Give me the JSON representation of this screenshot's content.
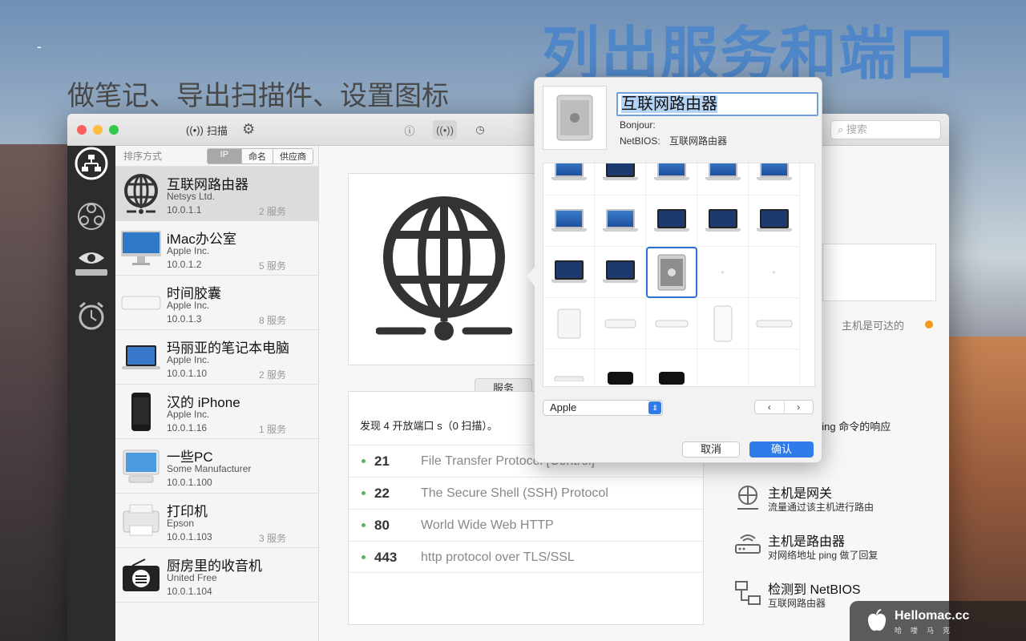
{
  "hero": {
    "title": "列出服务和端口",
    "subtitle": "做笔记、导出扫描件、设置图标",
    "dash": "-"
  },
  "toolbar": {
    "scan_label": "扫描",
    "search_placeholder": "搜索"
  },
  "sidebar": {
    "sort_label": "排序方式",
    "sort_options": [
      "IP",
      "命名",
      "供应商"
    ],
    "devices": [
      {
        "name": "互联网路由器",
        "vendor": "Netsys Ltd.",
        "ip": "10.0.1.1",
        "services": "2 服务",
        "icon": "globe-router-icon"
      },
      {
        "name": "iMac办公室",
        "vendor": "Apple Inc.",
        "ip": "10.0.1.2",
        "services": "5 服务",
        "icon": "imac-icon"
      },
      {
        "name": "时间胶囊",
        "vendor": "Apple Inc.",
        "ip": "10.0.1.3",
        "services": "8 服务",
        "icon": "time-capsule-icon"
      },
      {
        "name": "玛丽亚的笔记本电脑",
        "vendor": "Apple Inc.",
        "ip": "10.0.1.10",
        "services": "2 服务",
        "icon": "laptop-icon"
      },
      {
        "name": "汉的 iPhone",
        "vendor": "Apple Inc.",
        "ip": "10.0.1.16",
        "services": "1 服务",
        "icon": "iphone-icon"
      },
      {
        "name": "一些PC",
        "vendor": "Some Manufacturer",
        "ip": "10.0.1.100",
        "services": "",
        "icon": "pc-icon"
      },
      {
        "name": "打印机",
        "vendor": "Epson",
        "ip": "10.0.1.103",
        "services": "3 服务",
        "icon": "printer-icon"
      },
      {
        "name": "厨房里的收音机",
        "vendor": "United Free",
        "ip": "10.0.1.104",
        "services": "",
        "icon": "radio-icon"
      }
    ]
  },
  "services": {
    "tab_label": "服务",
    "summary": "发现 4 开放端口 s（0 扫描）。",
    "rows": [
      {
        "port": "21",
        "desc": "File Transfer Protocol [Control]"
      },
      {
        "port": "22",
        "desc": "The Secure Shell (SSH) Protocol"
      },
      {
        "port": "80",
        "desc": "World Wide Web HTTP"
      },
      {
        "port": "443",
        "desc": "http protocol over TLS/SSL"
      }
    ]
  },
  "right": {
    "reachable": "主机是可达的",
    "ping_text": "ping 命令的响应",
    "features": [
      {
        "title": "主机是网关",
        "desc": "流量通过该主机进行路由",
        "icon": "gateway-icon"
      },
      {
        "title": "主机是路由器",
        "desc": "对网络地址 ping 做了回复",
        "icon": "router-icon"
      },
      {
        "title": "检测到 NetBIOS",
        "desc": "互联网路由器",
        "icon": "netbios-icon"
      }
    ]
  },
  "popover": {
    "name_value": "互联网路由器",
    "bonjour_label": "Bonjour:",
    "netbios_label": "NetBIOS:",
    "netbios_value": "互联网路由器",
    "brand_selected": "Apple",
    "cancel_label": "取消",
    "ok_label": "确认",
    "pager_prev": "‹",
    "pager_next": "›"
  },
  "watermark": {
    "main": "Hellomac.cc",
    "sub": "哈喽马克"
  },
  "colors": {
    "accent_blue": "#2f7bea",
    "hero_blue": "#4f86c7",
    "status_orange": "#f5961e",
    "open_port_green": "#5ab45a"
  }
}
